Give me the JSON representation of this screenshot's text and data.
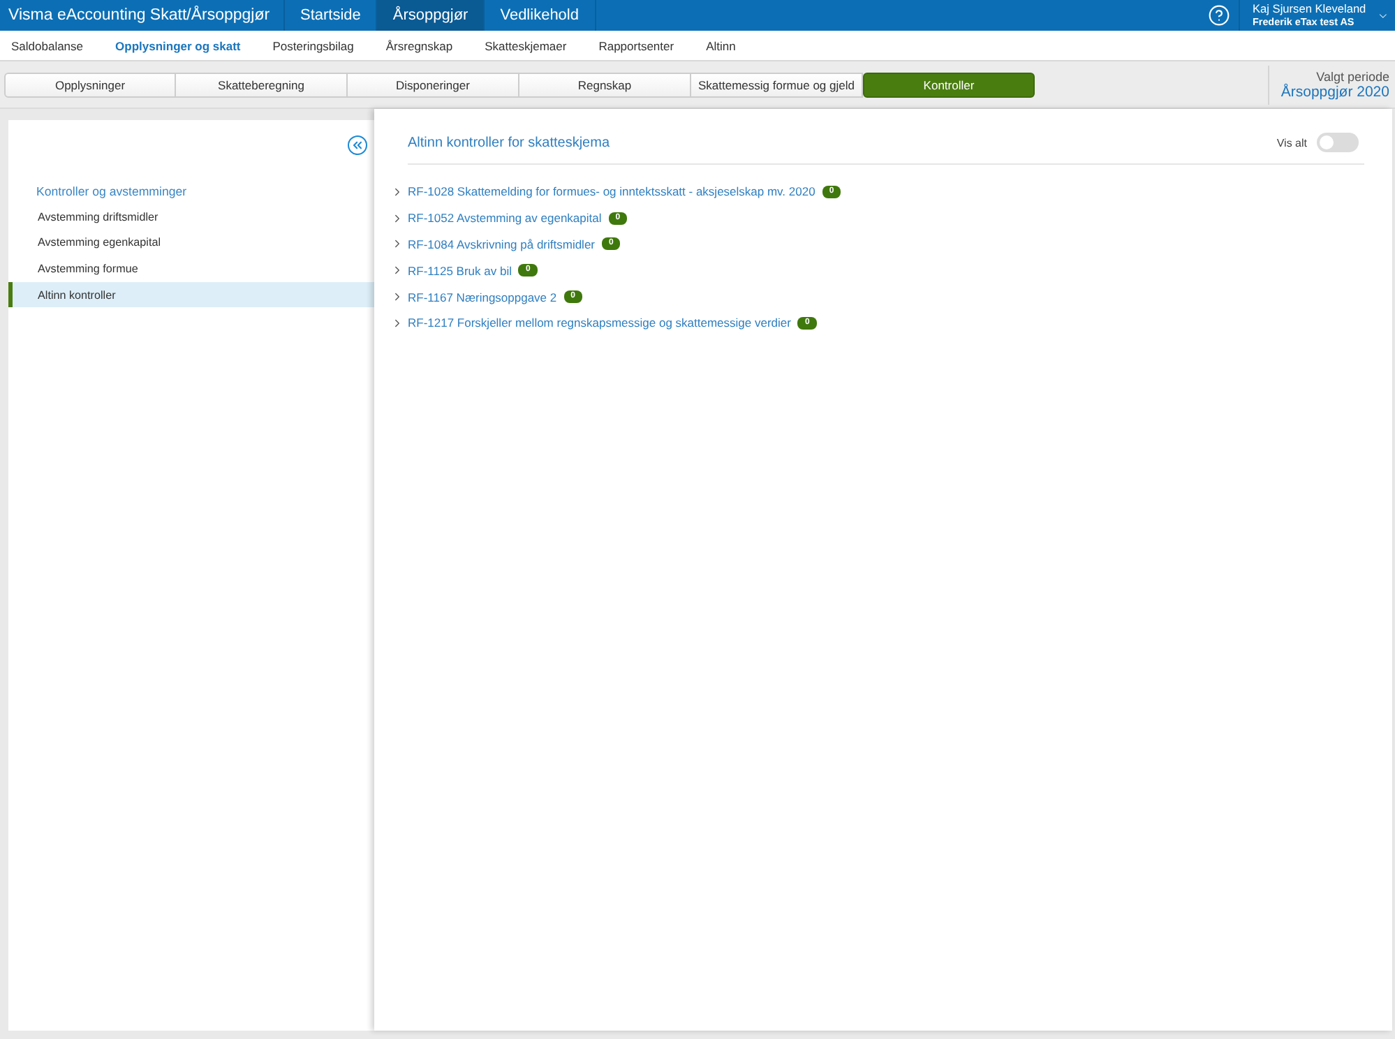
{
  "app_title": "Visma eAccounting Skatt/Årsoppgjør",
  "main_nav": [
    {
      "label": "Startside",
      "selected": false
    },
    {
      "label": "Årsoppgjør",
      "selected": true
    },
    {
      "label": "Vedlikehold",
      "selected": false
    }
  ],
  "user": {
    "name": "Kaj Sjursen Kleveland",
    "company": "Frederik eTax test AS"
  },
  "sub_nav": [
    {
      "label": "Saldobalanse",
      "selected": false
    },
    {
      "label": "Opplysninger og skatt",
      "selected": true
    },
    {
      "label": "Posteringsbilag",
      "selected": false
    },
    {
      "label": "Årsregnskap",
      "selected": false
    },
    {
      "label": "Skatteskjemaer",
      "selected": false
    },
    {
      "label": "Rapportsenter",
      "selected": false
    },
    {
      "label": "Altinn",
      "selected": false
    }
  ],
  "tabs": [
    {
      "label": "Opplysninger",
      "selected": false
    },
    {
      "label": "Skatteberegning",
      "selected": false
    },
    {
      "label": "Disponeringer",
      "selected": false
    },
    {
      "label": "Regnskap",
      "selected": false
    },
    {
      "label": "Skattemessig formue og gjeld",
      "selected": false
    },
    {
      "label": "Kontroller",
      "selected": true
    }
  ],
  "period": {
    "label": "Valgt periode",
    "value": "Årsoppgjør 2020"
  },
  "sidebar": {
    "heading": "Kontroller og avstemminger",
    "items": [
      {
        "label": "Avstemming driftsmidler",
        "selected": false
      },
      {
        "label": "Avstemming egenkapital",
        "selected": false
      },
      {
        "label": "Avstemming formue",
        "selected": false
      },
      {
        "label": "Altinn kontroller",
        "selected": true
      }
    ]
  },
  "content": {
    "title": "Altinn kontroller for skatteskjema",
    "show_all": {
      "label": "Vis alt",
      "on": false
    },
    "forms": [
      {
        "label": "RF-1028 Skattemelding for formues- og inntektsskatt - aksjeselskap mv. 2020",
        "count": "0",
        "expanded": false
      },
      {
        "label": "RF-1052 Avstemming av egenkapital",
        "count": "0",
        "expanded": false
      },
      {
        "label": "RF-1084 Avskrivning på driftsmidler",
        "count": "0",
        "expanded": false
      },
      {
        "label": "RF-1125 Bruk av bil",
        "count": "0",
        "expanded": false
      },
      {
        "label": "RF-1167 Næringsoppgave 2",
        "count": "0",
        "expanded": false
      },
      {
        "label": "RF-1217 Forskjeller mellom regnskapsmessige og skattemessige verdier",
        "count": "0",
        "expanded": false
      }
    ]
  }
}
